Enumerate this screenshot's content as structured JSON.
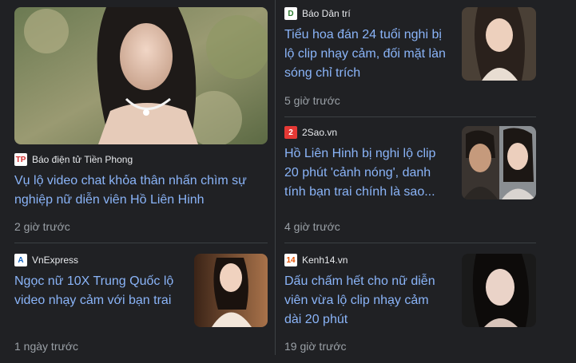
{
  "articles": [
    {
      "source": "Báo điện tử Tiền Phong",
      "logo_text": "TP",
      "logo_bg": "#ffffff",
      "logo_color": "#d32f2f",
      "title": "Vụ lộ video chat khỏa thân nhấn chìm sự nghiệp nữ diễn viên Hồ Liên Hinh",
      "time": "2 giờ trước"
    },
    {
      "source": "Báo Dân trí",
      "logo_text": "D",
      "logo_bg": "#ffffff",
      "logo_color": "#2e7d32",
      "title": "Tiểu hoa đán 24 tuổi nghi bị lộ clip nhạy cảm, đối mặt làn sóng chỉ trích",
      "time": "5 giờ trước"
    },
    {
      "source": "2Sao.vn",
      "logo_text": "2",
      "logo_bg": "#e53935",
      "logo_color": "#ffffff",
      "title": "Hồ Liên Hinh bị nghi lộ clip 20 phút 'cảnh nóng', danh tính bạn trai chính là sao...",
      "time": "4 giờ trước"
    },
    {
      "source": "VnExpress",
      "logo_text": "A",
      "logo_bg": "#ffffff",
      "logo_color": "#1565c0",
      "title": "Ngọc nữ 10X Trung Quốc lộ video nhạy cảm với bạn trai",
      "time": "1 ngày trước"
    },
    {
      "source": "Kenh14.vn",
      "logo_text": "14",
      "logo_bg": "#ffffff",
      "logo_color": "#e65100",
      "title": "Dấu chấm hết cho nữ diễn viên vừa lộ clip nhạy cảm dài 20 phút",
      "time": "19 giờ trước"
    }
  ]
}
